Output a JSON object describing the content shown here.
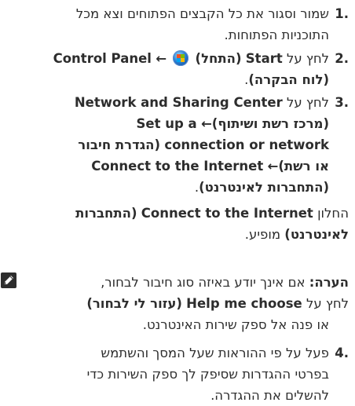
{
  "step1": {
    "number": "1.",
    "line1": "שמור וסגור את כל הקבצים הפתוחים וצא מכל",
    "line2": "התוכניות הפתוחות."
  },
  "step2": {
    "number": "2.",
    "prefix": "לחץ על",
    "start_en": "Start",
    "start_he": "(התחל)",
    "arrow": "←",
    "control_panel_en": "Control Panel",
    "control_panel_he": "(לוח הבקרה)",
    "period": "."
  },
  "step3": {
    "number": "3.",
    "prefix": "לחץ על",
    "nsc_en": "Network and Sharing Center",
    "nsc_he": "(מרכז רשת ושיתוף)",
    "arrow": "←",
    "setup_part1": "Set up a",
    "setup_part2": "connection or network",
    "setup_he_part1": "(הגדרת חיבור",
    "setup_he_part2": "או רשת)",
    "connect_en": "Connect to the Internet",
    "connect_he": "(התחברות לאינטרנט)",
    "period": "."
  },
  "window_text": {
    "prefix": "החלון",
    "connect_en": "Connect to the Internet",
    "connect_he_part1": "(התחברות",
    "connect_he_part2": "לאינטרנט)",
    "suffix": "מופיע."
  },
  "note": {
    "icon": "pencil-note-icon",
    "label": "הערה:",
    "line1": "אם אינך יודע באיזה סוג חיבור לבחור,",
    "line2_prefix": "לחץ על",
    "help_en": "Help me choose",
    "help_he": "(עזור לי לבחור)",
    "line3": "או פנה אל ספק שירות האינטרנט."
  },
  "step4": {
    "number": "4.",
    "line1": "פעל על פי ההוראות שעל המסך והשתמש",
    "line2": "בפרטי ההגדרות שסיפק לך ספק השירות כדי",
    "line3": "להשלים את ההגדרה."
  }
}
